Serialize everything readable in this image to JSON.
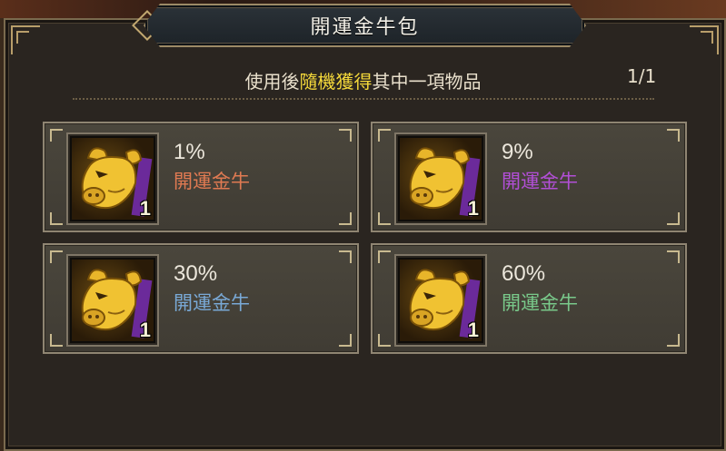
{
  "dialog": {
    "title": "開運金牛包",
    "instruction_pre": "使用後",
    "instruction_highlight": "隨機獲得",
    "instruction_post": "其中一項物品",
    "page_indicator": "1/1"
  },
  "items": [
    {
      "chance": "1%",
      "name": "開運金牛",
      "name_color": "#e07a52",
      "quantity": "1"
    },
    {
      "chance": "9%",
      "name": "開運金牛",
      "name_color": "#b24fd6",
      "quantity": "1"
    },
    {
      "chance": "30%",
      "name": "開運金牛",
      "name_color": "#79a9d6",
      "quantity": "1"
    },
    {
      "chance": "60%",
      "name": "開運金牛",
      "name_color": "#79c98a",
      "quantity": "1"
    }
  ],
  "colors": {
    "highlight": "#f4d83a",
    "text": "#e9e0cc",
    "title_text": "#f2efe6",
    "frame": "#b89e6a"
  },
  "icons": {
    "item": "golden-bull-head-icon"
  }
}
